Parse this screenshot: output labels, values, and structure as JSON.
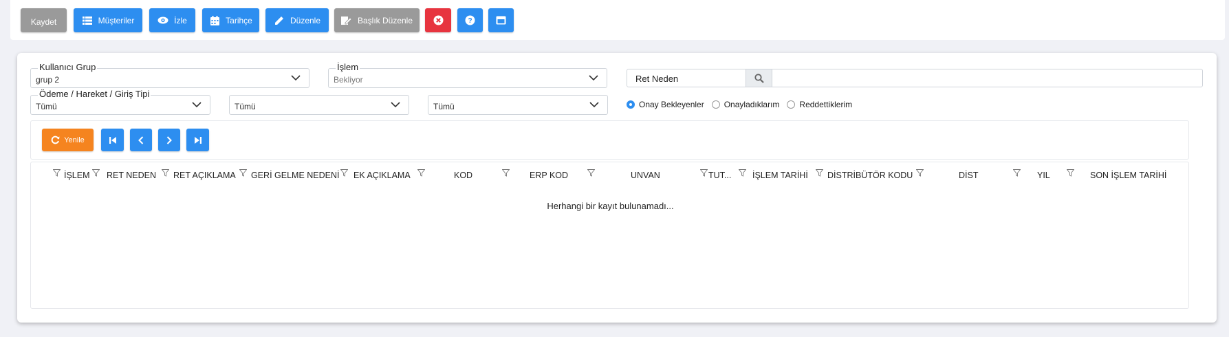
{
  "toolbar": {
    "save": "Kaydet",
    "customers": "Müşteriler",
    "watch": "İzle",
    "history": "Tarihçe",
    "edit": "Düzenle",
    "header_edit": "Başlık Düzenle"
  },
  "filters": {
    "user_group": {
      "label": "Kullanıcı Grup",
      "value": "grup 2"
    },
    "operation": {
      "label": "İşlem",
      "value": "Bekliyor"
    },
    "payment_type": {
      "label": "Ödeme / Hareket / Giriş Tipi",
      "value": "Tümü"
    },
    "select2": {
      "value": "Tümü"
    },
    "select3": {
      "value": "Tümü"
    },
    "reject_reason": {
      "label": "Ret Neden",
      "value": ""
    },
    "radios": [
      {
        "label": "Onay Bekleyenler",
        "checked": true
      },
      {
        "label": "Onayladıklarım",
        "checked": false
      },
      {
        "label": "Reddettiklerim",
        "checked": false
      }
    ]
  },
  "nav": {
    "refresh": "Yenile"
  },
  "grid": {
    "columns": [
      "İŞLEM",
      "RET NEDEN",
      "RET AÇIKLAMA",
      "GERİ GELME NEDENİ",
      "EK AÇIKLAMA",
      "KOD",
      "ERP KOD",
      "UNVAN",
      "TUT...",
      "İŞLEM TARİHİ",
      "DİSTRİBÜTÖR KODU",
      "DİST",
      "YIL",
      "SON İŞLEM TARİHİ"
    ],
    "empty_message": "Herhangi bir kayıt bulunamadı..."
  },
  "colors": {
    "blue": "#2d8ef0",
    "gray": "#9a9a9a",
    "red": "#e7343f",
    "orange": "#f5841f"
  }
}
